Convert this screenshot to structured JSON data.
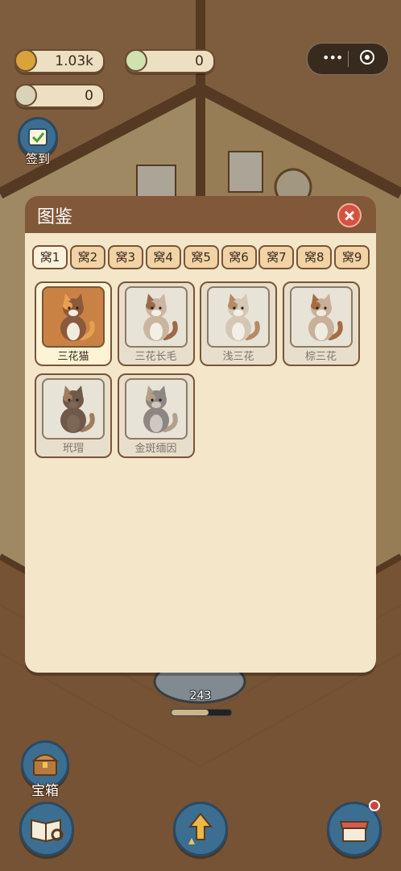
{
  "hud": {
    "coins": "1.03k",
    "grass": "0",
    "leaves": "0",
    "signin_label": "签到"
  },
  "capsule": {
    "more_icon": "•••",
    "target_icon": "target-icon"
  },
  "bottom": {
    "chest_label": "宝箱",
    "counter": "243",
    "progress": 0.62
  },
  "modal": {
    "title": "图鉴",
    "tabs": [
      "窝1",
      "窝2",
      "窝3",
      "窝4",
      "窝5",
      "窝6",
      "窝7",
      "窝8",
      "窝9"
    ],
    "active_tab": 0,
    "cats": [
      {
        "name": "三花猫",
        "active": true,
        "body": "#8b5a3c",
        "patch": "#e8a050",
        "belly": "#f2ece0"
      },
      {
        "name": "三花长毛",
        "active": false,
        "body": "#c9b5a0",
        "patch": "#9a6a4a",
        "belly": "#f4efe6"
      },
      {
        "name": "浅三花",
        "active": false,
        "body": "#d5c7b5",
        "patch": "#b58a68",
        "belly": "#f4efe6"
      },
      {
        "name": "棕三花",
        "active": false,
        "body": "#c8b09a",
        "patch": "#a56c45",
        "belly": "#f2ece0"
      },
      {
        "name": "玳瑁",
        "active": false,
        "body": "#6f5a4a",
        "patch": "#a27d5c",
        "belly": "#7c6655"
      },
      {
        "name": "金斑缅因",
        "active": false,
        "body": "#8d8682",
        "patch": "#b4a089",
        "belly": "#cfc8c0"
      }
    ]
  },
  "colors": {
    "header": "#815838",
    "panel": "#f3e6c9",
    "close": "#d6513f",
    "border": "#7a5436"
  }
}
